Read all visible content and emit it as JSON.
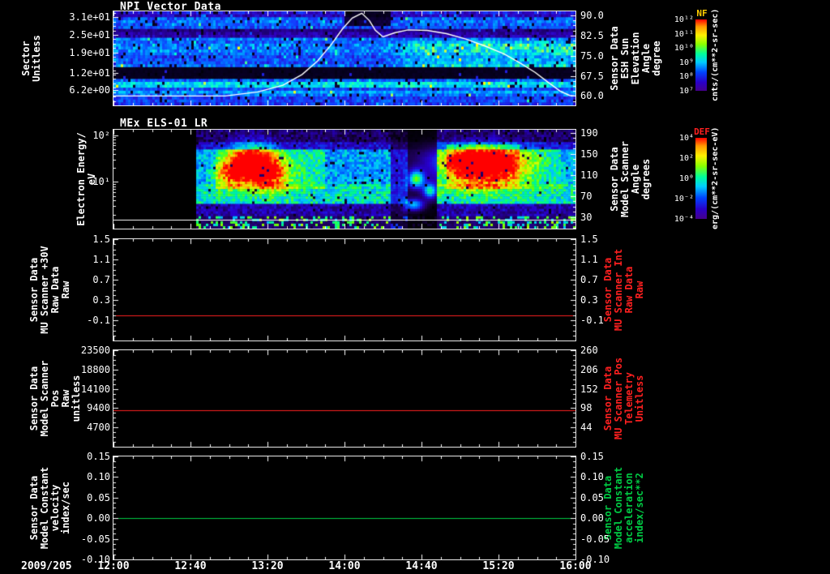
{
  "window": {
    "bg": "#000000",
    "fg": "#ffffff"
  },
  "xaxis": {
    "date_label": "2009/205",
    "tick_labels": [
      "12:00",
      "12:40",
      "13:20",
      "14:00",
      "14:40",
      "15:20",
      "16:00"
    ],
    "minutes_span": 240
  },
  "panels": {
    "npi": {
      "chart_index": 0,
      "type": "spectrogram",
      "title": "NPI Vector Data",
      "left_label": [
        "Sector",
        "Unitless"
      ],
      "left_ticks": {
        "labels": [
          "3.1e+01",
          "2.5e+01",
          "1.9e+01",
          "1.2e+01",
          "6.2e+00"
        ],
        "values": [
          31,
          25,
          19,
          12,
          6.2
        ],
        "ylim": [
          1,
          33
        ]
      },
      "right_label": [
        "Sensor Data",
        "ESH Sun Elevation",
        "Angle",
        "degree"
      ],
      "right_label_color": "#ffffff",
      "right_ticks": {
        "labels": [
          "90.0",
          "82.5",
          "75.0",
          "67.5",
          "60.0"
        ],
        "values": [
          90,
          82.5,
          75,
          67.5,
          60
        ],
        "ylim": [
          56.5,
          91.5
        ]
      },
      "features": {
        "dark_bands": [
          {
            "s0": 0.58,
            "s1": 0.72,
            "factor": 0.06
          },
          {
            "s0": 0.2,
            "s1": 0.27,
            "factor": 0.4
          }
        ],
        "bright_bands": [
          {
            "s0": 0.74,
            "s1": 0.82,
            "level": 0.62
          },
          {
            "s0": 0.83,
            "s1": 0.88,
            "level": 0.5
          }
        ],
        "brighten_after": {
          "t": 0.58,
          "s0": 0.3,
          "s1": 0.58,
          "amount": 0.22
        },
        "dark_blob": {
          "t0": 0.5,
          "t1": 0.6,
          "s1": 0.16,
          "factor": 0.12
        }
      }
    },
    "els": {
      "chart_index": 1,
      "type": "spectrogram",
      "title": "MEx ELS-01 LR",
      "left_label": [
        "Electron Energy/",
        "eV"
      ],
      "left_ticks": {
        "labels": [
          "10²",
          "10¹"
        ],
        "values": [
          100,
          10
        ],
        "ylim": [
          1,
          130
        ],
        "log": true
      },
      "right_label": [
        "Sensor Data",
        "Model Scanner",
        "Angle",
        "degrees"
      ],
      "right_label_color": "#ffffff",
      "right_ticks": {
        "labels": [
          "190",
          "150",
          "110",
          "70",
          "30"
        ],
        "values": [
          190,
          150,
          110,
          70,
          30
        ],
        "ylim": [
          8,
          196
        ]
      },
      "overlay": {
        "color": "#ffffff",
        "y_frac": 0.91
      },
      "features": {
        "data_start": 0.18,
        "warm_regions": [
          [
            0.22,
            0.46,
            0.2,
            0.6,
            0.12
          ],
          [
            0.72,
            0.88,
            0.15,
            0.6,
            0.15
          ],
          [
            0.88,
            0.97,
            0.2,
            0.6,
            0.06
          ]
        ],
        "blobs": [
          [
            0.3,
            0.33,
            0.035,
            0.13,
            0.6
          ],
          [
            0.255,
            0.45,
            0.025,
            0.1,
            0.35
          ],
          [
            0.34,
            0.46,
            0.03,
            0.12,
            0.4
          ],
          [
            0.8,
            0.3,
            0.07,
            0.1,
            0.6
          ],
          [
            0.8,
            0.47,
            0.07,
            0.12,
            0.35
          ],
          [
            0.655,
            0.5,
            0.012,
            0.06,
            0.6
          ],
          [
            0.685,
            0.62,
            0.01,
            0.05,
            0.5
          ],
          [
            0.65,
            0.76,
            0.015,
            0.04,
            0.45
          ]
        ],
        "gap": [
          0.635,
          0.7,
          0.08
        ],
        "dim": [
          0.6,
          0.635,
          0.5
        ]
      }
    },
    "mu30v": {
      "chart_index": 2,
      "type": "line",
      "left_label": [
        "Sensor Data",
        "MU Scanner +30V",
        "Raw Data",
        "Raw"
      ],
      "left_ticks": {
        "labels": [
          "1.5",
          "1.1",
          "0.7",
          "0.3",
          "-0.1"
        ],
        "values": [
          1.5,
          1.1,
          0.7,
          0.3,
          -0.1
        ],
        "ylim": [
          -0.5,
          1.5
        ]
      },
      "right_label": [
        "Sensor Data",
        "MU Scanner Int",
        "Raw Data",
        "Raw"
      ],
      "right_label_color": "#ff2020",
      "right_ticks": {
        "labels": [
          "1.5",
          "1.1",
          "0.7",
          "0.3",
          "-0.1"
        ],
        "values": [
          1.5,
          1.1,
          0.7,
          0.3,
          -0.1
        ],
        "ylim": [
          -0.5,
          1.5
        ]
      }
    },
    "scanpos": {
      "chart_index": 3,
      "type": "line",
      "left_label": [
        "Sensor Data",
        "Model Scanner Pos",
        "Raw",
        "unitless"
      ],
      "left_ticks": {
        "labels": [
          "23500",
          "18800",
          "14100",
          "9400",
          "4700"
        ],
        "values": [
          23500,
          18800,
          14100,
          9400,
          4700
        ],
        "ylim": [
          0,
          23500
        ]
      },
      "right_label": [
        "Sensor Data",
        "MU Scanner Pos",
        "Telemetry",
        "Unitless"
      ],
      "right_label_color": "#ff2020",
      "right_ticks": {
        "labels": [
          "260",
          "206",
          "152",
          "98",
          "44"
        ],
        "values": [
          260,
          206,
          152,
          98,
          44
        ],
        "ylim": [
          -10,
          260
        ]
      }
    },
    "velocity": {
      "chart_index": 4,
      "type": "line",
      "left_label": [
        "Sensor Data",
        "Model Constant",
        "velocity",
        "index/sec"
      ],
      "left_ticks": {
        "labels": [
          "0.15",
          "0.10",
          "0.05",
          "0.00",
          "-0.05",
          "-0.10"
        ],
        "values": [
          0.15,
          0.1,
          0.05,
          0,
          -0.05,
          -0.1
        ],
        "ylim": [
          -0.1,
          0.15
        ]
      },
      "right_label": [
        "Sensor Data",
        "Model Constant",
        "acceleration",
        "index/sec**2"
      ],
      "right_label_color": "#00cc44",
      "right_ticks": {
        "labels": [
          "0.15",
          "0.10",
          "0.05",
          "0.00",
          "-0.05",
          "-0.10"
        ],
        "values": [
          0.15,
          0.1,
          0.05,
          0,
          -0.05,
          -0.1
        ],
        "ylim": [
          -0.1,
          0.15
        ]
      }
    }
  },
  "colorbars": [
    {
      "title": "NF",
      "title_color": "#ffcc00",
      "ticks": [
        "10¹²",
        "10¹¹",
        "10¹⁰",
        "10⁹",
        "10⁸",
        "10⁷"
      ],
      "units": "cnts/(cm**2-sr-sec)"
    },
    {
      "title": "DEF",
      "title_color": "#ff2020",
      "ticks": [
        "10⁴",
        "10²",
        "10⁰",
        "10⁻²",
        "10⁻⁴"
      ],
      "units": "erg/(cm**2-sr-sec-eV)"
    }
  ],
  "chart_data": [
    {
      "type": "heatmap",
      "title": "NPI Vector Data",
      "xlabel": "time (2009/205 12:00-16:00)",
      "x_ticks": [
        "12:00",
        "12:40",
        "13:20",
        "14:00",
        "14:40",
        "15:20",
        "16:00"
      ],
      "ylabel": "Sector (Unitless)",
      "ylim": [
        1,
        33
      ],
      "y_ticks": [
        31,
        25,
        19,
        12,
        6.2
      ],
      "colorbar": {
        "name": "NF",
        "units": "cnts/(cm**2-sr-sec)"
      },
      "right_axis": {
        "label": "Sensor Data ESH Sun Elevation Angle (degree)",
        "ticks": [
          90,
          82.5,
          75,
          67.5,
          60
        ],
        "ylim": [
          56.5,
          91.5
        ]
      },
      "overlay_series": {
        "name": "ESH Sun Elevation Angle",
        "units": "degree",
        "color": "#ffffff",
        "points_min_deg": [
          [
            0,
            60
          ],
          [
            58,
            60
          ],
          [
            75,
            61.5
          ],
          [
            88,
            64
          ],
          [
            98,
            68
          ],
          [
            106,
            73
          ],
          [
            113,
            79
          ],
          [
            119,
            85
          ],
          [
            124,
            89
          ],
          [
            129,
            90.8
          ],
          [
            133,
            88
          ],
          [
            136,
            84.5
          ],
          [
            140,
            82
          ],
          [
            146,
            83.5
          ],
          [
            153,
            84.6
          ],
          [
            163,
            84.4
          ],
          [
            173,
            83.2
          ],
          [
            183,
            81.2
          ],
          [
            193,
            78.6
          ],
          [
            203,
            75.6
          ],
          [
            211,
            72.4
          ],
          [
            219,
            68.8
          ],
          [
            226,
            65
          ],
          [
            232,
            61.8
          ],
          [
            237,
            60.2
          ],
          [
            240,
            60
          ]
        ]
      },
      "description": "Blue/cyan sector-vs-time count spectrogram; black band near sectors 10-13; bright cyan rows near sectors 5-8; mid-sector brightening after ~14:20; dark patch in upper sectors near 14:00-14:25."
    },
    {
      "type": "heatmap",
      "title": "MEx ELS-01 LR",
      "ylabel": "Electron Energy (eV)",
      "yscale": "log",
      "ylim": [
        1,
        130
      ],
      "y_ticks": [
        100,
        10
      ],
      "colorbar": {
        "name": "DEF",
        "units": "erg/(cm**2-sr-sec-eV)"
      },
      "right_axis": {
        "label": "Sensor Data Model Scanner Angle (degrees)",
        "ticks": [
          190,
          150,
          110,
          70,
          30
        ],
        "ylim": [
          8,
          196
        ]
      },
      "description": "No data before ~12:43; rainbow electron energy-flux spectrogram 12:43-16:00; intense red/yellow bursts near 13:05-13:30 and 15:00-15:40 between ~10 and 100 eV; near-total data gap ~14:32-14:48 with isolated green patches; persistent green band near 5-20 eV; white baseline near 2 eV."
    },
    {
      "type": "line",
      "ylabel": "Sensor Data MU Scanner +30V Raw Data (Raw)",
      "ylim": [
        -0.5,
        1.5
      ],
      "y_ticks": [
        1.5,
        1.1,
        0.7,
        0.3,
        -0.1
      ],
      "series": [
        {
          "name": "MU Scanner +30V Raw",
          "color": "#ff2020",
          "constant_value": 0.0
        }
      ],
      "right_axis": {
        "label": "Sensor Data MU Scanner Int Raw Data (Raw)",
        "ticks": [
          1.5,
          1.1,
          0.7,
          0.3,
          -0.1
        ]
      }
    },
    {
      "type": "line",
      "ylabel": "Sensor Data Model Scanner Pos Raw (unitless)",
      "ylim": [
        0,
        23500
      ],
      "y_ticks": [
        23500,
        18800,
        14100,
        9400,
        4700
      ],
      "series": [
        {
          "name": "Model Scanner Pos Raw",
          "color": "#ff2020",
          "constant_value": 8880
        }
      ],
      "right_axis": {
        "label": "Sensor Data MU Scanner Pos Telemetry (Unitless)",
        "ticks": [
          260,
          206,
          152,
          98,
          44
        ],
        "ylim": [
          -10,
          260
        ]
      }
    },
    {
      "type": "line",
      "ylabel": "Sensor Data Model Constant velocity (index/sec)",
      "ylim": [
        -0.1,
        0.15
      ],
      "y_ticks": [
        0.15,
        0.1,
        0.05,
        0,
        -0.05,
        -0.1
      ],
      "series": [
        {
          "name": "Model Constant velocity",
          "color": "#00cc44",
          "constant_value": 0.0
        }
      ],
      "right_axis": {
        "label": "Sensor Data Model Constant acceleration (index/sec**2)",
        "ticks": [
          0.15,
          0.1,
          0.05,
          0,
          -0.05,
          -0.1
        ]
      }
    }
  ]
}
